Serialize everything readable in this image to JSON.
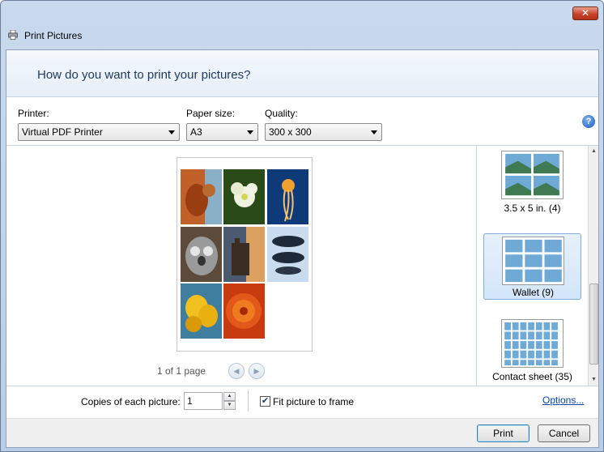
{
  "window": {
    "title": "Print Pictures",
    "close_glyph": "✕"
  },
  "header": {
    "question": "How do you want to print your pictures?"
  },
  "settings": {
    "printer_label": "Printer:",
    "printer_value": "Virtual PDF Printer",
    "paper_label": "Paper size:",
    "paper_value": "A3",
    "quality_label": "Quality:",
    "quality_value": "300 x 300",
    "help_glyph": "?"
  },
  "preview": {
    "pager_text": "1 of 1 page",
    "prev_glyph": "◀",
    "next_glyph": "▶"
  },
  "layouts": [
    {
      "label": "3.5 x 5 in. (4)",
      "selected": false
    },
    {
      "label": "Wallet (9)",
      "selected": true
    },
    {
      "label": "Contact sheet (35)",
      "selected": false
    }
  ],
  "options": {
    "copies_label": "Copies of each picture:",
    "copies_value": "1",
    "fit_label": "Fit picture to frame",
    "fit_checked": true,
    "check_glyph": "✔",
    "options_link": "Options..."
  },
  "footer": {
    "print_label": "Print",
    "cancel_label": "Cancel"
  },
  "icons": {
    "window_icon": "printer-icon",
    "help": "help-icon"
  }
}
